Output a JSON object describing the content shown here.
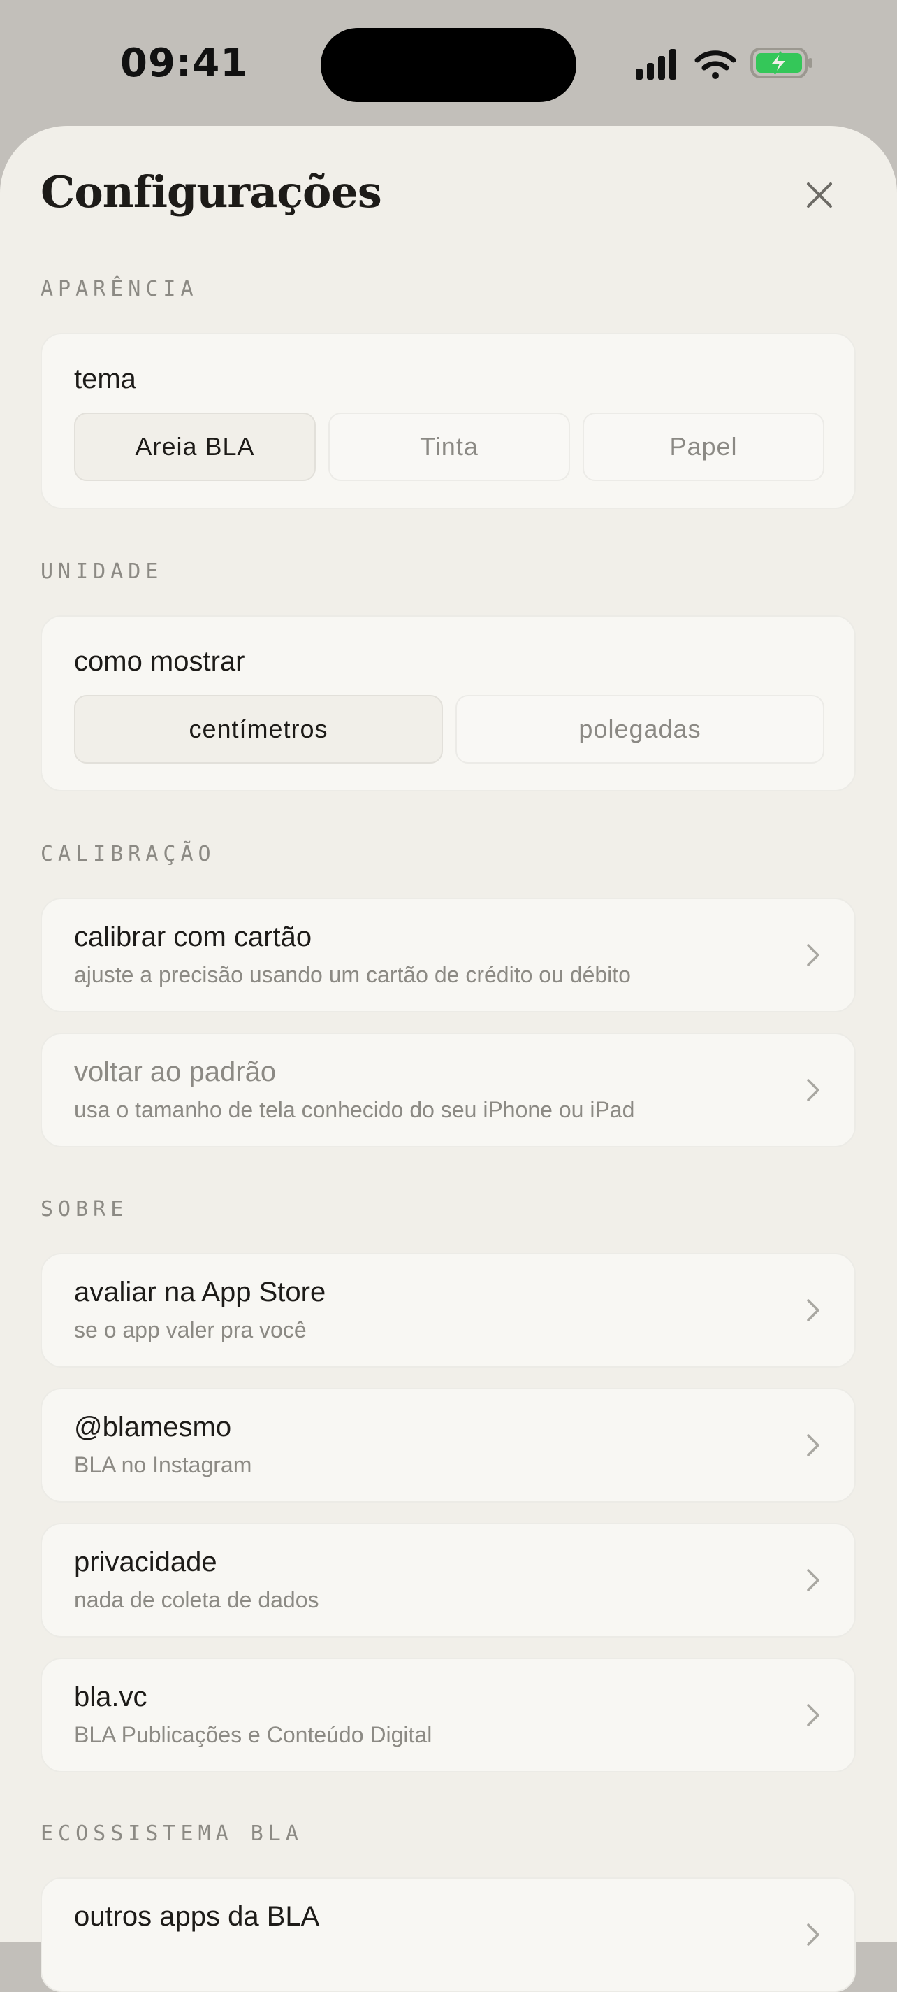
{
  "status_bar": {
    "time": "09:41"
  },
  "sheet": {
    "title": "Configurações"
  },
  "sections": {
    "aparencia": "APARÊNCIA",
    "unidade": "UNIDADE",
    "calibracao": "CALIBRAÇÃO",
    "sobre": "SOBRE",
    "ecossistema": "ECOSSISTEMA BLA"
  },
  "theme": {
    "label": "tema",
    "options": [
      "Areia BLA",
      "Tinta",
      "Papel"
    ],
    "selected": "Areia BLA"
  },
  "unit": {
    "label": "como mostrar",
    "options": [
      "centímetros",
      "polegadas"
    ],
    "selected": "centímetros"
  },
  "calibration": [
    {
      "title": "calibrar com cartão",
      "subtitle": "ajuste a precisão usando um cartão de crédito ou débito"
    },
    {
      "title": "voltar ao padrão",
      "subtitle": "usa o tamanho de tela conhecido do seu iPhone ou iPad"
    }
  ],
  "about": [
    {
      "title": "avaliar na App Store",
      "subtitle": "se o app valer pra você"
    },
    {
      "title": "@blamesmo",
      "subtitle": "BLA no Instagram"
    },
    {
      "title": "privacidade",
      "subtitle": "nada de coleta de dados"
    },
    {
      "title": "bla.vc",
      "subtitle": "BLA Publicações e Conteúdo Digital"
    }
  ],
  "ecosystem": [
    {
      "title": "outros apps da BLA"
    }
  ],
  "colors": {
    "backdrop": "#c2bfba",
    "sheet": "#f1efe9",
    "card": "#f8f7f3",
    "text": "#1d1b18",
    "muted": "#8c8a84",
    "battery_green": "#34c759"
  }
}
